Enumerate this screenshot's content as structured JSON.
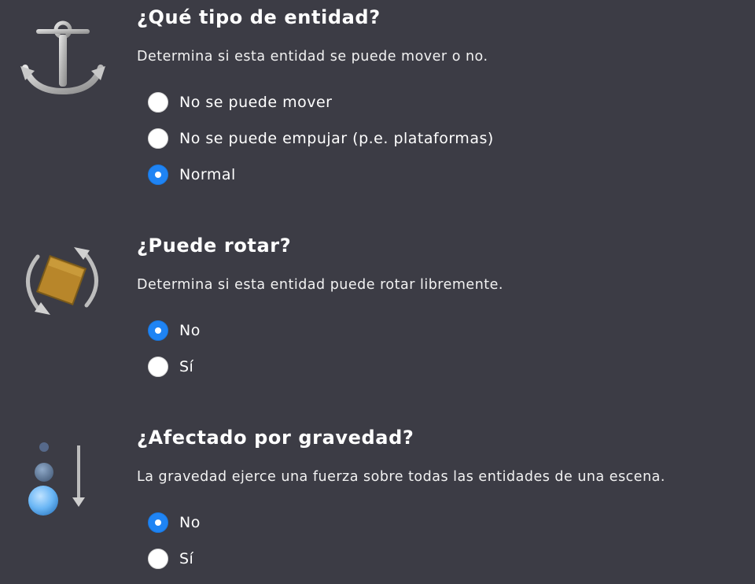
{
  "sections": [
    {
      "icon": "anchor-icon",
      "title": "¿Qué tipo de entidad?",
      "description": "Determina si esta entidad se puede mover o no.",
      "options": [
        {
          "label": "No se puede mover",
          "selected": false
        },
        {
          "label": "No se puede empujar (p.e. plataformas)",
          "selected": false
        },
        {
          "label": "Normal",
          "selected": true
        }
      ]
    },
    {
      "icon": "rotate-icon",
      "title": "¿Puede rotar?",
      "description": "Determina si esta entidad puede rotar libremente.",
      "options": [
        {
          "label": "No",
          "selected": true
        },
        {
          "label": "Sí",
          "selected": false
        }
      ]
    },
    {
      "icon": "gravity-icon",
      "title": "¿Afectado por gravedad?",
      "description": "La gravedad ejerce una fuerza sobre todas las entidades de una escena.",
      "options": [
        {
          "label": "No",
          "selected": true
        },
        {
          "label": "Sí",
          "selected": false
        }
      ]
    }
  ],
  "colors": {
    "background": "#3c3c45",
    "radio_selected": "#1f84f4",
    "text": "#ffffff"
  }
}
